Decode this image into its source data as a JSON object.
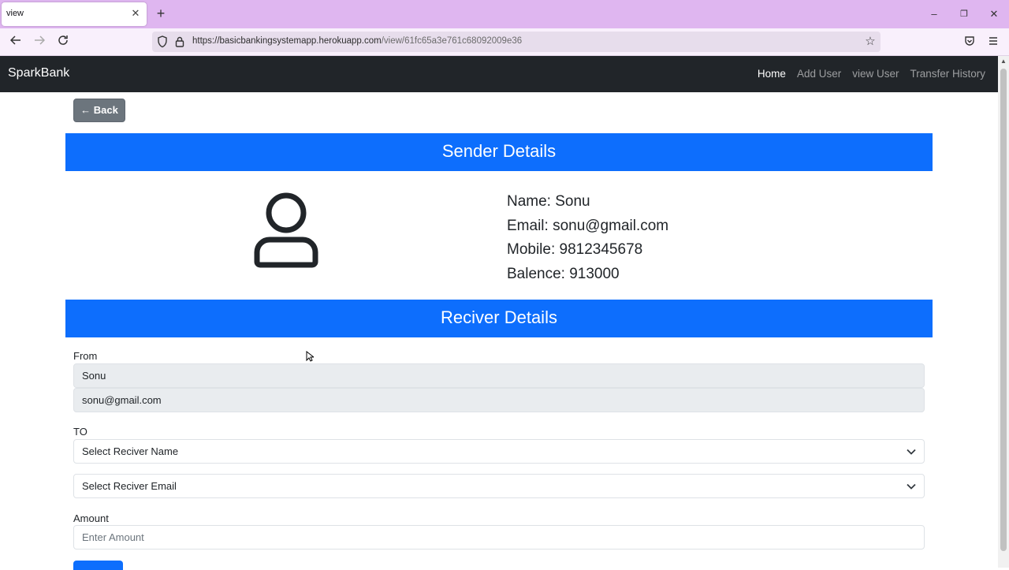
{
  "browser": {
    "tab_title": "view",
    "tab_close": "✕",
    "new_tab": "+",
    "url_host": "https://basicbankingsystemapp.herokuapp.com",
    "url_path": "/view/61fc65a3e761c68092009e36",
    "window_controls": {
      "minimize": "–",
      "restore": "❐",
      "close": "✕"
    }
  },
  "site": {
    "brand": "SparkBank",
    "nav": [
      {
        "label": "Home",
        "active": true
      },
      {
        "label": "Add User",
        "active": false
      },
      {
        "label": "view User",
        "active": false
      },
      {
        "label": "Transfer History",
        "active": false
      }
    ]
  },
  "back_button": "← Back",
  "sender": {
    "header": "Sender Details",
    "name": "Name: Sonu",
    "email": "Email: sonu@gmail.com",
    "mobile": "Mobile: 9812345678",
    "balance": "Balence: 913000"
  },
  "receiver": {
    "header": "Reciver Details",
    "from_label": "From",
    "from_name": "Sonu",
    "from_email": "sonu@gmail.com",
    "to_label": "TO",
    "name_select": "Select Reciver Name",
    "email_select": "Select Reciver Email",
    "amount_label": "Amount",
    "amount_placeholder": "Enter Amount"
  },
  "colors": {
    "primary": "#0d6efd",
    "navbar": "#212529",
    "secondary": "#6c757d",
    "browser_tabbar": "#dfb6f0"
  }
}
